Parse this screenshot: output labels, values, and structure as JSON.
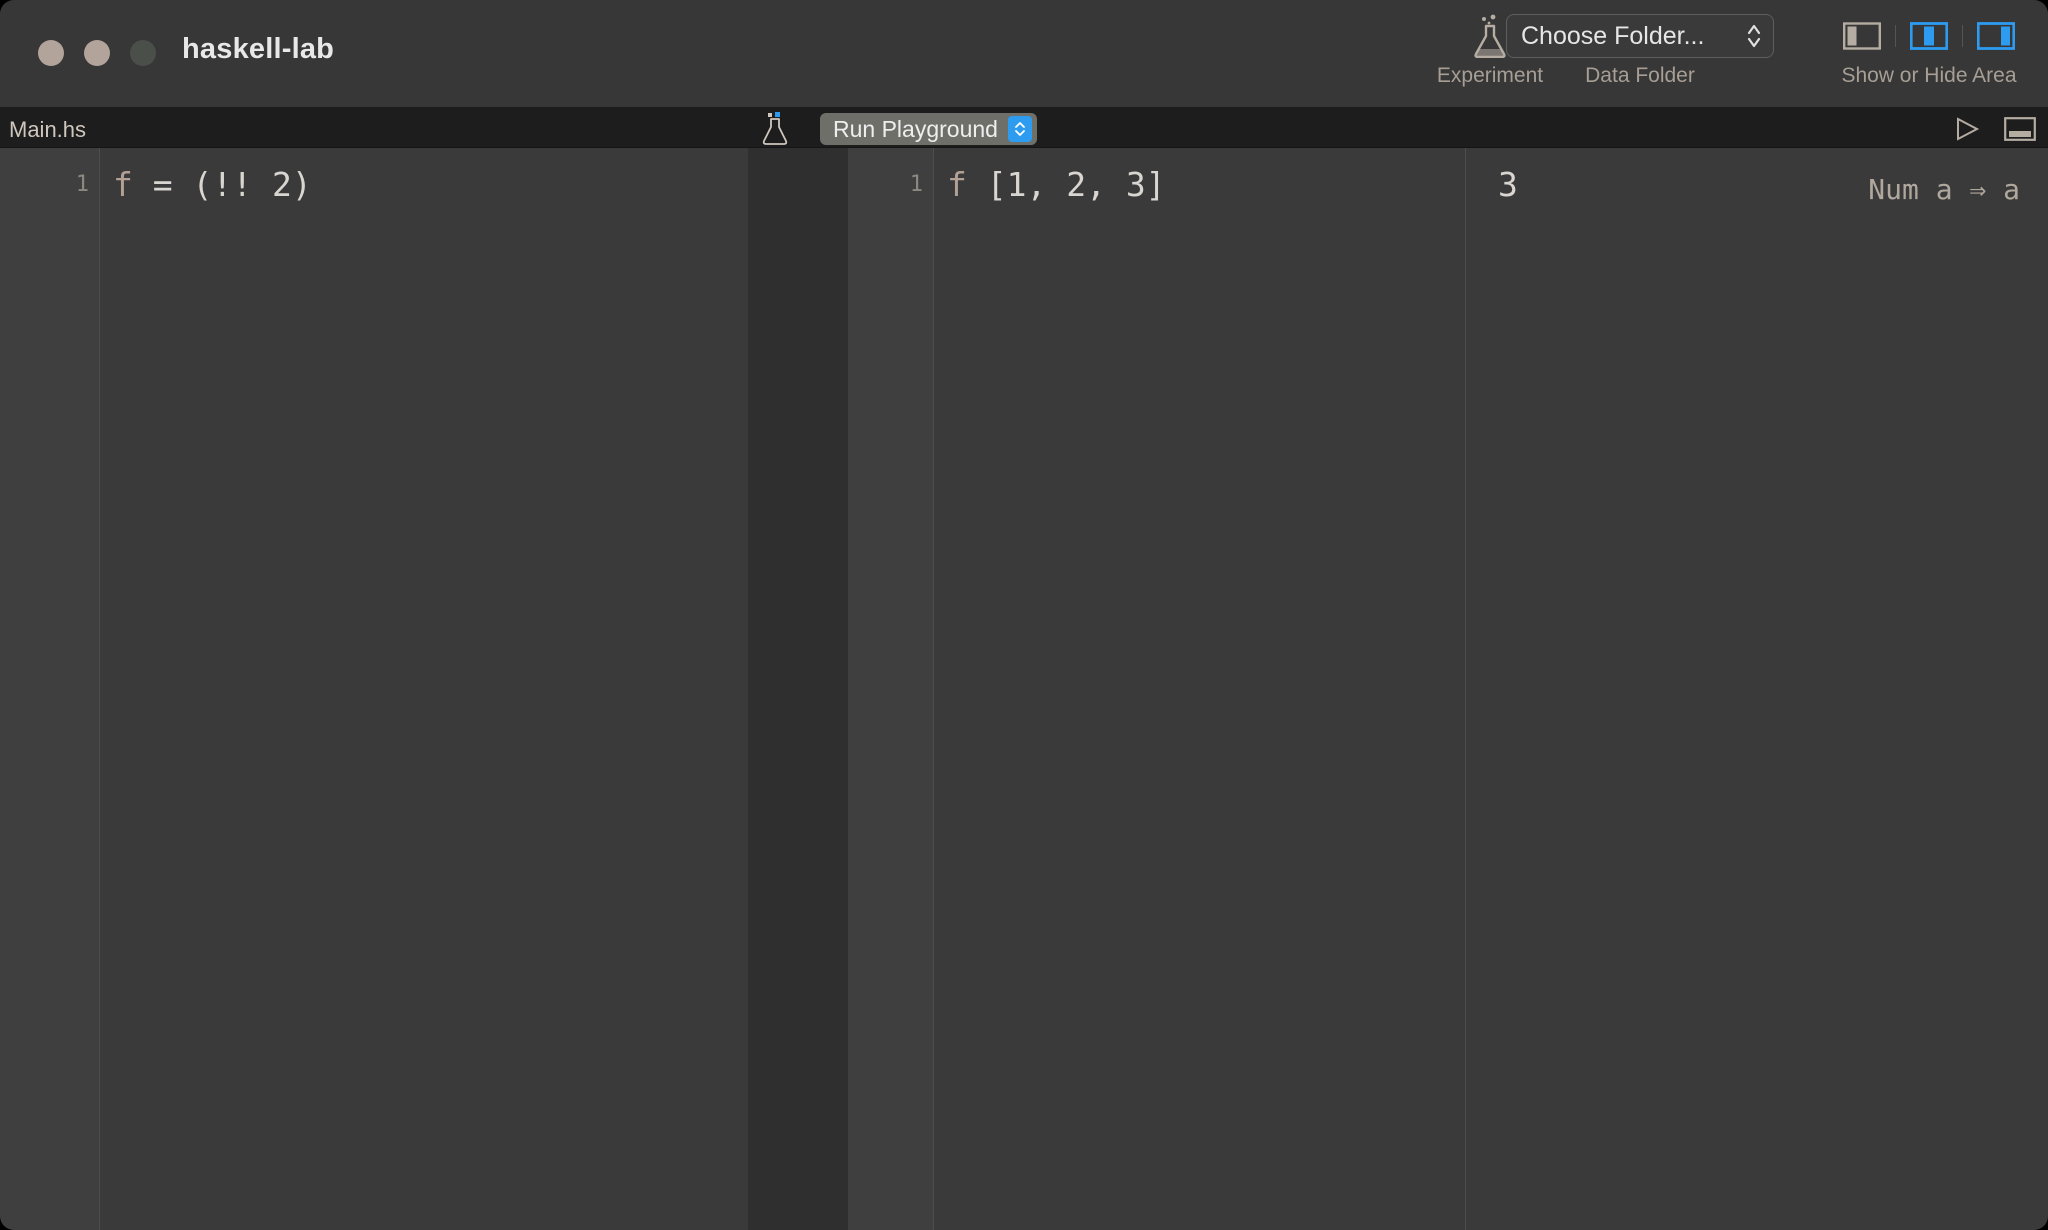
{
  "window": {
    "title": "haskell-lab",
    "traffic_lights": [
      {
        "name": "close",
        "color": "#b3a49b"
      },
      {
        "name": "minimize",
        "color": "#b3a49b"
      },
      {
        "name": "zoom",
        "color": "#4a4f4a"
      }
    ]
  },
  "toolbar": {
    "experiment": {
      "icon": "flask-icon",
      "label": "Experiment"
    },
    "data_folder": {
      "button_value": "Choose Folder...",
      "label": "Data Folder",
      "icon": "updown-chevron-icon"
    },
    "show_hide_area": {
      "label": "Show or Hide Area",
      "toggles": [
        {
          "name": "left-panel-toggle",
          "active": false,
          "color": "#b5aca2"
        },
        {
          "name": "middle-panel-toggle",
          "active": true,
          "color": "#2d9bf0"
        },
        {
          "name": "right-panel-toggle",
          "active": true,
          "color": "#2d9bf0"
        }
      ]
    }
  },
  "tabstrip": {
    "filename": "Main.hs",
    "flask_icon": "flask-icon",
    "run_playground": {
      "label": "Run Playground",
      "stepper_color": "#2d9bf0"
    },
    "run_icon": "play-triangle-icon",
    "console_icon": "bottom-panel-icon"
  },
  "editor": {
    "source_pane": {
      "line_numbers": [
        "1"
      ],
      "lines": [
        {
          "fn": "f",
          "rest": " = (!! 2)"
        }
      ]
    },
    "playground_pane": {
      "line_numbers": [
        "1"
      ],
      "lines": [
        {
          "fn": "f",
          "rest": " [1, 2, 3]"
        }
      ]
    },
    "result_pane": {
      "value": "3",
      "type_signature": "Num a ⇒ a"
    }
  },
  "colors": {
    "window_bg": "#333333",
    "titlebar_bg": "#373737",
    "tabstrip_bg": "#1d1d1d",
    "editor_bg": "#3a3a3a",
    "gutter_bg": "#3f3f3f",
    "accent_blue": "#2d9bf0",
    "text_primary": "#e8e8e8",
    "text_secondary": "#a79e95",
    "token_function": "#b3a094"
  }
}
